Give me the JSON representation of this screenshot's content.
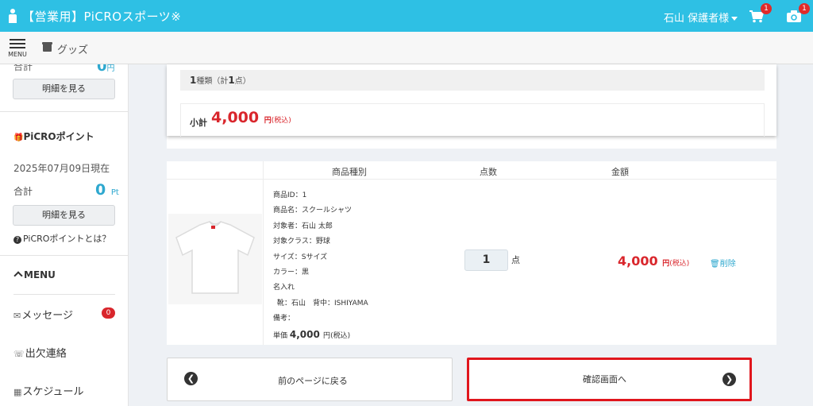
{
  "header": {
    "app_title": "【営業用】PiCROスポーツ※",
    "user_name": "石山 保護者様",
    "cart_badge": "1",
    "camera_badge": "1"
  },
  "subbar": {
    "menu_label": "MENU",
    "breadcrumb": "グッズ"
  },
  "sidebar": {
    "top_total_label": "合計",
    "top_total_value": "0",
    "top_total_unit": "円",
    "detail_button_1": "明細を見る",
    "points_heading": "PiCROポイント",
    "points_date": "2025年07月09日現在",
    "points_total_label": "合計",
    "points_total_value": "0",
    "points_total_unit": "Pt",
    "detail_button_2": "明細を見る",
    "points_help": "PiCROポイントとは？",
    "menu_heading": "MENU",
    "nav": {
      "messages": "メッセージ",
      "messages_badge": "0",
      "attendance": "出欠連絡",
      "schedule": "スケジュール"
    }
  },
  "summary": {
    "kinds_prefix": "1",
    "kinds_text": "種類（計",
    "kinds_count": "1",
    "kinds_suffix": "点）",
    "subtotal_label": "小計",
    "subtotal_amount": "4,000",
    "subtotal_yen": "円",
    "subtotal_tax": "(税込)"
  },
  "table": {
    "headers": {
      "product_type": "商品種別",
      "quantity": "点数",
      "amount": "金額"
    },
    "row": {
      "product_id": "商品ID：1",
      "product_name": "商品名：スクールシャツ",
      "target": "対象者：石山 太郎",
      "target_class": "対象クラス：野球",
      "size": "サイズ：Sサイズ",
      "color": "カラー：黒",
      "name_print": "名入れ",
      "name_print_detail": "靴：石山　背中：ISHIYAMA",
      "remarks": "備考：",
      "unit_price_label": "単価",
      "unit_price": "4,000",
      "unit_price_yen": "円",
      "unit_price_tax": "(税込)",
      "quantity": "1",
      "quantity_unit": "点",
      "line_total": "4,000",
      "line_total_yen": "円",
      "line_total_tax": "(税込)",
      "delete": "削除"
    }
  },
  "buttons": {
    "back": "前のページに戻る",
    "next": "確認画面へ"
  }
}
